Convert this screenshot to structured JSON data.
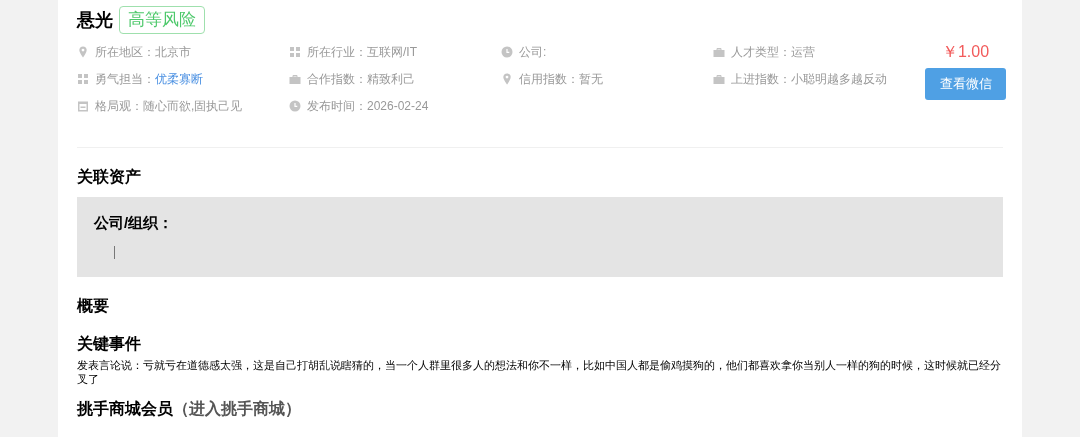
{
  "profile": {
    "name": "悬光",
    "risk_badge": "高等风险"
  },
  "info": [
    {
      "kind": "text",
      "label": "所在地区：",
      "value": "北京市"
    },
    {
      "kind": "text",
      "label": "所在行业：",
      "value": "互联网/IT"
    },
    {
      "kind": "empty",
      "label": "公司:"
    },
    {
      "kind": "text",
      "label": "人才类型：",
      "value": "运营"
    },
    {
      "kind": "link",
      "label": "勇气担当：",
      "value": "优柔寡断"
    },
    {
      "kind": "text",
      "label": "合作指数：",
      "value": "精致利己"
    },
    {
      "kind": "text",
      "label": "信用指数：",
      "value": "暂无"
    },
    {
      "kind": "text",
      "label": "上进指数：",
      "value": "小聪明越多越反动"
    },
    {
      "kind": "text",
      "label": "格局观：",
      "value": "随心而欲,固执己见"
    },
    {
      "kind": "text",
      "label": "发布时间：",
      "value": "2026-02-24"
    }
  ],
  "price": "￥1.00",
  "wechat_button": "查看微信",
  "assets": {
    "title": "关联资产",
    "label": "公司/组织："
  },
  "summary": {
    "title": "概要"
  },
  "events": {
    "title": "关键事件",
    "text": "发表言论说：亏就亏在道德感太强，这是自己打胡乱说瞎猜的，当一个人群里很多人的想法和你不一样，比如中国人都是偷鸡摸狗的，他们都喜欢拿你当别人一样的狗的时候，这时候就已经分叉了"
  },
  "mall": {
    "title": "挑手商城会员",
    "link": "（进入挑手商城）"
  }
}
